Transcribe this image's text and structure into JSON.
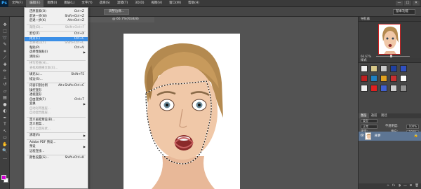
{
  "app": {
    "logo": "Ps"
  },
  "menubar": {
    "items": [
      "文件(F)",
      "编辑(E)",
      "图像(I)",
      "图层(L)",
      "文字(Y)",
      "选择(S)",
      "滤镜(T)",
      "3D(D)",
      "视图(V)",
      "窗口(W)",
      "帮助(H)"
    ],
    "window_controls": [
      "—",
      "□",
      "✕"
    ]
  },
  "optionsbar": {
    "refine_edge": "调整边缘...",
    "workspace": "基本功能"
  },
  "document_tab": {
    "title": "@ 66.7%(RGB/8)"
  },
  "edit_menu": {
    "items": [
      {
        "label": "还原套索(O)",
        "shortcut": "Ctrl+Z",
        "state": "normal"
      },
      {
        "label": "前进一步(W)",
        "shortcut": "Shift+Ctrl+Z",
        "state": "normal"
      },
      {
        "label": "后退一步(K)",
        "shortcut": "Alt+Ctrl+Z",
        "state": "normal"
      },
      {
        "sep": true
      },
      {
        "label": "渐隐(D)...",
        "shortcut": "Shift+Ctrl+F",
        "state": "disabled"
      },
      {
        "sep": true
      },
      {
        "label": "剪切(T)",
        "shortcut": "Ctrl+X",
        "state": "normal"
      },
      {
        "label": "拷贝(C)",
        "shortcut": "Ctrl+C",
        "state": "highlighted"
      },
      {
        "label": "合并拷贝(Y)",
        "shortcut": "Shift+Ctrl+C",
        "state": "disabled"
      },
      {
        "label": "粘贴(P)",
        "shortcut": "Ctrl+V",
        "state": "normal"
      },
      {
        "label": "选择性粘贴(I)",
        "shortcut": "",
        "state": "normal",
        "submenu": true
      },
      {
        "label": "清除(E)",
        "shortcut": "",
        "state": "normal"
      },
      {
        "sep": true
      },
      {
        "label": "拼写检查(H)...",
        "shortcut": "",
        "state": "disabled"
      },
      {
        "label": "查找和替换文本(X)...",
        "shortcut": "",
        "state": "disabled"
      },
      {
        "sep": true
      },
      {
        "label": "填充(L)...",
        "shortcut": "Shift+F5",
        "state": "normal"
      },
      {
        "label": "描边(S)...",
        "shortcut": "",
        "state": "normal"
      },
      {
        "sep": true
      },
      {
        "label": "内容识别比例",
        "shortcut": "Alt+Shift+Ctrl+C",
        "state": "normal"
      },
      {
        "label": "操控变形",
        "shortcut": "",
        "state": "normal"
      },
      {
        "label": "透视变形",
        "shortcut": "",
        "state": "normal"
      },
      {
        "label": "自由变换(F)",
        "shortcut": "Ctrl+T",
        "state": "normal"
      },
      {
        "label": "变换",
        "shortcut": "",
        "state": "normal",
        "submenu": true
      },
      {
        "label": "自动对齐图层...",
        "shortcut": "",
        "state": "disabled"
      },
      {
        "label": "自动混合图层...",
        "shortcut": "",
        "state": "disabled"
      },
      {
        "sep": true
      },
      {
        "label": "定义画笔预设(B)...",
        "shortcut": "",
        "state": "normal"
      },
      {
        "label": "定义图案...",
        "shortcut": "",
        "state": "normal"
      },
      {
        "label": "定义自定形状...",
        "shortcut": "",
        "state": "disabled"
      },
      {
        "sep": true
      },
      {
        "label": "清理(R)",
        "shortcut": "",
        "state": "normal",
        "submenu": true
      },
      {
        "sep": true
      },
      {
        "label": "Adobe PDF 预设...",
        "shortcut": "",
        "state": "normal"
      },
      {
        "label": "预设",
        "shortcut": "",
        "state": "normal",
        "submenu": true
      },
      {
        "label": "远程连接...",
        "shortcut": "",
        "state": "normal"
      },
      {
        "sep": true
      },
      {
        "label": "颜色设置(G)...",
        "shortcut": "Shift+Ctrl+K",
        "state": "normal"
      }
    ]
  },
  "navigator": {
    "title": "导航器",
    "zoom": "66.67%"
  },
  "swatches_panel": {
    "title": "样式",
    "colors": [
      "#f0f0f0",
      "#d8c888",
      "#c8c8c8",
      "#2040a0",
      "#3050c0",
      "#c02020",
      "#2080c0",
      "#e0a020",
      "#c83030",
      "#ffffff",
      "#f0f0f0",
      "#e02020",
      "#4060d0",
      "#d0d0d0",
      "#909090"
    ]
  },
  "layers_panel": {
    "tabs": [
      "图层",
      "通道",
      "路径"
    ],
    "kind_label": "类型",
    "blend_mode": "正常",
    "opacity_label": "不透明度:",
    "opacity_value": "100%",
    "lock_label": "锁定:",
    "fill_label": "填充:",
    "fill_value": "100%",
    "layer_name": "背景",
    "footer_icons": [
      "∞",
      "fx",
      "◑",
      "▭",
      "⊞",
      "🗑"
    ]
  }
}
